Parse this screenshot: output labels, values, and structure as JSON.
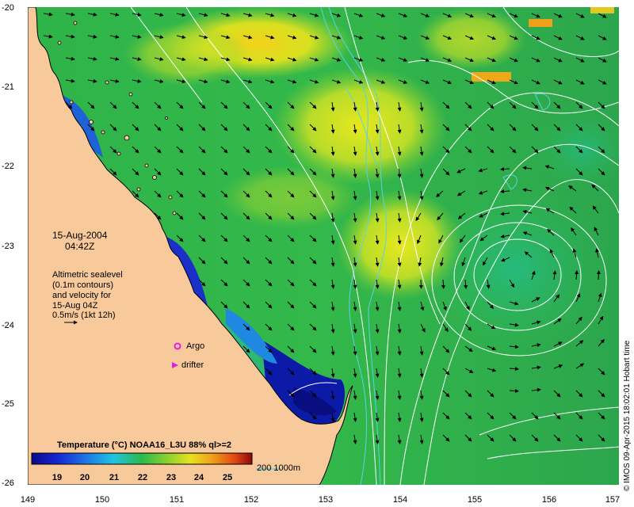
{
  "map": {
    "lat_labels": [
      "-20",
      "-21",
      "-22",
      "-23",
      "-24",
      "-25",
      "-26"
    ],
    "lon_labels": [
      "149",
      "150",
      "151",
      "152",
      "153",
      "154",
      "155",
      "156",
      "157"
    ],
    "lat_range": [
      -26,
      -20
    ],
    "lon_range": [
      149,
      157
    ]
  },
  "date": {
    "day": "15-Aug-2004",
    "time": "04:42Z"
  },
  "legend": {
    "line1": "Altimetric sealevel",
    "line2": "(0.1m contours)",
    "line3": "and velocity for",
    "line4": "15-Aug 04Z",
    "line5": "0.5m/s (1kt 12h)",
    "argo": "Argo",
    "drifter": "drifter",
    "depth": "200  1000m"
  },
  "colorbar": {
    "title": "Temperature (°C) NOAA16_L3U 88% ql>=2",
    "ticks": [
      "19",
      "20",
      "21",
      "22",
      "23",
      "24",
      "25"
    ],
    "range": [
      18,
      26
    ]
  },
  "credit": "© IMOS 09-Apr-2015 18:02:01  Hobart time",
  "colors": {
    "land": "#f7c99b",
    "coast": "#000000",
    "arrow": "#000000",
    "contour": "#ffffff",
    "isobath": "#5ad2e6",
    "argo": "#e020e0",
    "drifter": "#e020e0"
  }
}
